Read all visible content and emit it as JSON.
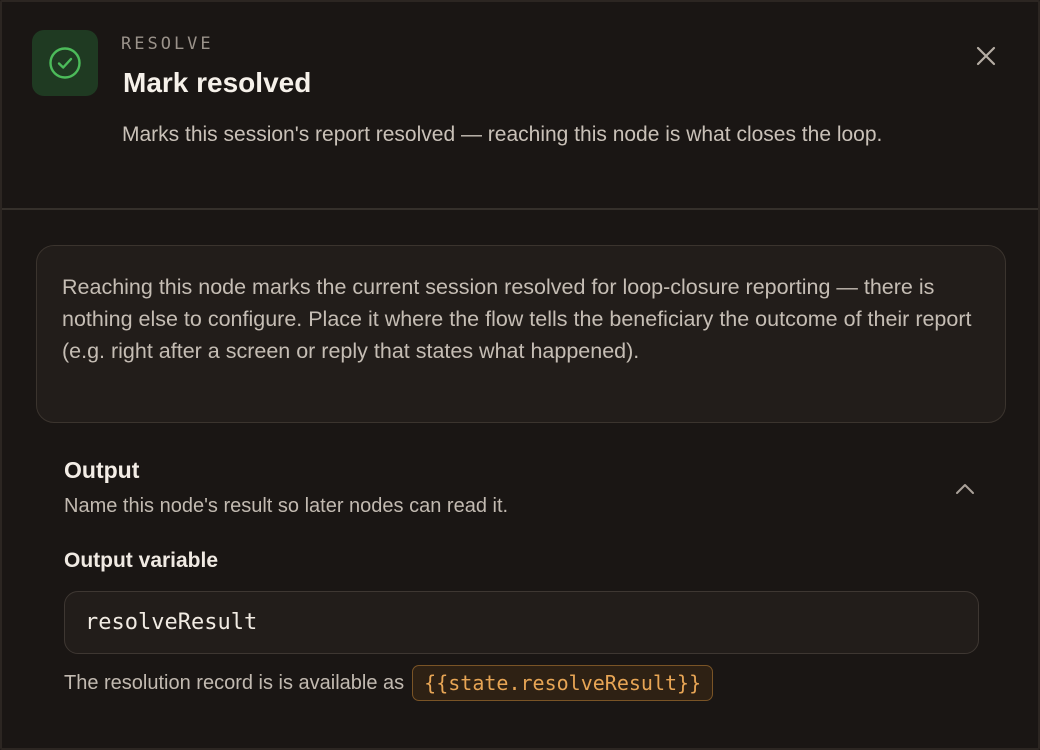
{
  "header": {
    "icon": "check-circle-icon",
    "kind_label": "RESOLVE",
    "title": "Mark resolved",
    "subtitle": "Marks this session's report resolved — reaching this node is what closes the loop.",
    "close_icon": "close-icon"
  },
  "info": {
    "text": "Reaching this node marks the current session resolved for loop-closure reporting — there is nothing else to configure. Place it where the flow tells the beneficiary the outcome of their report (e.g. right after a screen or reply that states what happened)."
  },
  "output": {
    "title": "Output",
    "description": "Name this node's result so later nodes can read it.",
    "collapse_icon": "chevron-up-icon",
    "variable_label": "Output variable",
    "variable_value": "resolveResult",
    "hint_prefix": "The resolution record is is available as",
    "hint_code": "{{state.resolveResult}}"
  },
  "colors": {
    "background": "#1a1614",
    "success_green": "#4cbb5a",
    "code_accent": "#e7a555"
  }
}
